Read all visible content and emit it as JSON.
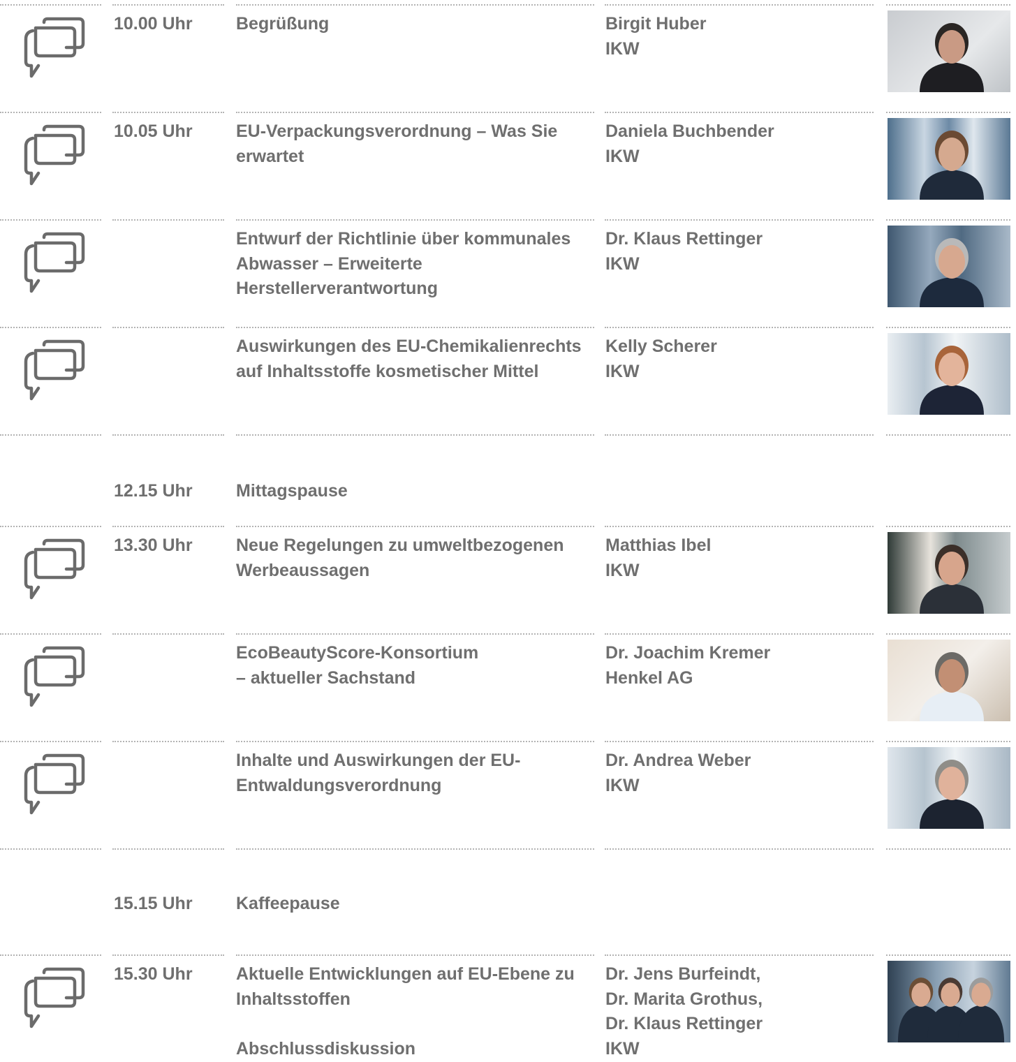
{
  "rows": [
    {
      "time": "10.00 Uhr",
      "title_lines": [
        "Begrüßung"
      ],
      "speaker_lines": [
        "Birgit Huber",
        "IKW"
      ],
      "photo": "portrait-woman-dark-hair",
      "icon": "speech-bubbles-icon"
    },
    {
      "time": "10.05 Uhr",
      "title_lines": [
        "EU-Verpackungsverordnung – Was Sie",
        "erwartet"
      ],
      "speaker_lines": [
        "Daniela Buchbender",
        "IKW"
      ],
      "photo": "portrait-woman-braid",
      "icon": "speech-bubbles-icon"
    },
    {
      "time": "",
      "title_lines": [
        "Entwurf der Richtlinie über kommunales",
        "Abwasser – Erweiterte",
        "Herstellerverantwortung"
      ],
      "speaker_lines": [
        "Dr. Klaus Rettinger",
        "IKW"
      ],
      "photo": "portrait-man-glasses",
      "icon": "speech-bubbles-icon"
    },
    {
      "time": "",
      "title_lines": [
        "Auswirkungen des EU-Chemikalienrechts",
        "auf Inhaltsstoffe kosmetischer Mittel"
      ],
      "speaker_lines": [
        "Kelly Scherer",
        "IKW"
      ],
      "photo": "portrait-woman-curly-hair",
      "icon": "speech-bubbles-icon"
    },
    {
      "time": "12.15 Uhr",
      "title_lines": [
        "Mittagspause"
      ],
      "speaker_lines": [],
      "photo": "",
      "icon": ""
    },
    {
      "time": "13.30 Uhr",
      "title_lines": [
        "Neue Regelungen zu umweltbezogenen",
        "Werbeaussagen"
      ],
      "speaker_lines": [
        "Matthias Ibel",
        "IKW"
      ],
      "photo": "portrait-man-red-tie",
      "icon": "speech-bubbles-icon"
    },
    {
      "time": "",
      "title_lines": [
        "EcoBeautyScore-Konsortium",
        "– aktueller Sachstand"
      ],
      "speaker_lines": [
        "Dr. Joachim Kremer",
        "Henkel AG"
      ],
      "photo": "portrait-man-grey-hair",
      "icon": "speech-bubbles-icon"
    },
    {
      "time": "",
      "title_lines": [
        "Inhalte und Auswirkungen der EU-",
        "Entwaldungsverordnung"
      ],
      "speaker_lines": [
        "Dr. Andrea Weber",
        "IKW"
      ],
      "photo": "portrait-woman-short-grey-hair",
      "icon": "speech-bubbles-icon"
    },
    {
      "time": "15.15 Uhr",
      "title_lines": [
        "Kaffeepause"
      ],
      "speaker_lines": [],
      "photo": "",
      "icon": ""
    },
    {
      "time": "15.30 Uhr",
      "title_lines": [
        "Aktuelle Entwicklungen auf EU-Ebene zu",
        "Inhaltsstoffen",
        "",
        "Abschlussdiskussion"
      ],
      "speaker_lines": [
        "Dr. Jens Burfeindt,",
        "Dr. Marita Grothus,",
        "Dr. Klaus Rettinger",
        "IKW"
      ],
      "photo": "group-photo-three-people",
      "icon": "speech-bubbles-icon"
    }
  ],
  "colors": {
    "text": "#6f6f6f",
    "rule": "#b3b3b3",
    "icon": "#6b6b6b"
  }
}
